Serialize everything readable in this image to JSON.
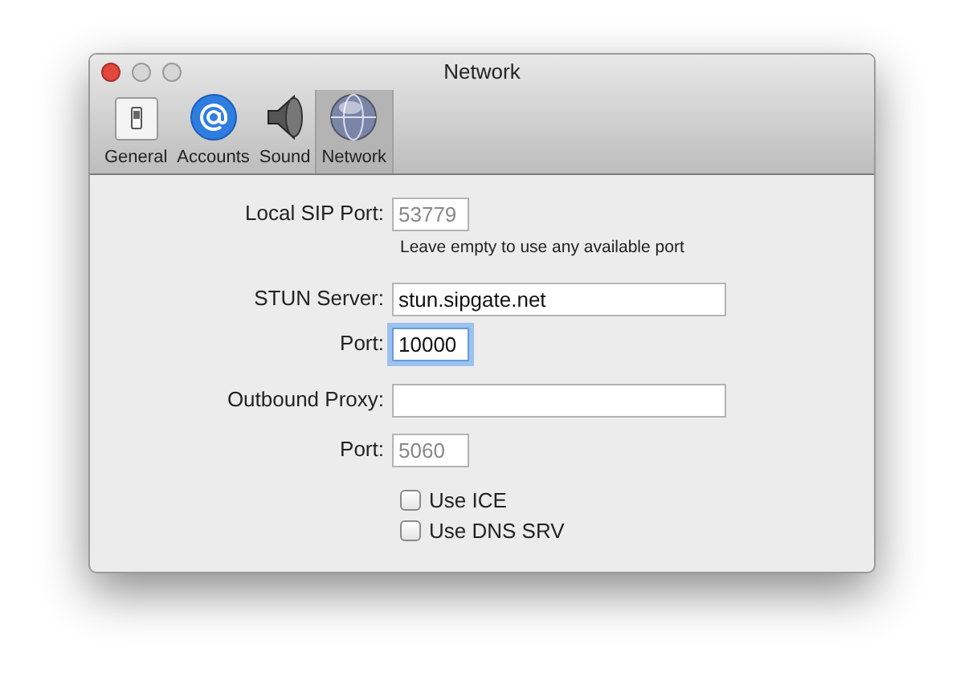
{
  "window": {
    "title": "Network"
  },
  "tabs": [
    {
      "label": "General",
      "kind": "switch",
      "selected": false
    },
    {
      "label": "Accounts",
      "kind": "at",
      "selected": false
    },
    {
      "label": "Sound",
      "kind": "speaker",
      "selected": false
    },
    {
      "label": "Network",
      "kind": "globe",
      "selected": true
    }
  ],
  "rows": [
    {
      "kind": "short_field",
      "label": "Local SIP Port:",
      "placeholder": "53779",
      "focused": false
    },
    {
      "kind": "hint",
      "text": "Leave empty to use any available port"
    },
    {
      "kind": "long_field",
      "label": "STUN Server:",
      "value": "stun.sipgate.net",
      "focused": false
    },
    {
      "kind": "short_field",
      "label": "Port:",
      "value": "10000",
      "focused": true
    },
    {
      "kind": "long_field",
      "label": "Outbound Proxy:",
      "focused": false
    },
    {
      "kind": "short_field",
      "label": "Port:",
      "placeholder": "5060",
      "focused": false
    },
    {
      "kind": "checkbox",
      "label": "Use ICE",
      "checked": false
    },
    {
      "kind": "checkbox",
      "label": "Use DNS SRV",
      "checked": false
    }
  ]
}
